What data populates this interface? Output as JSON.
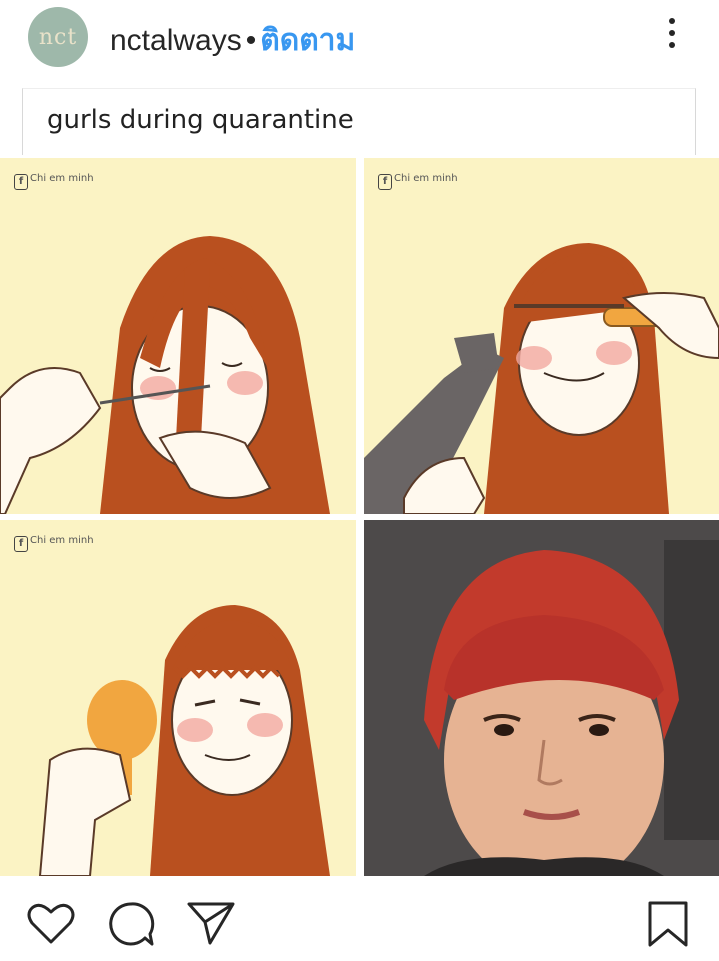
{
  "post": {
    "username": "nctalways",
    "separator": "•",
    "follow_label": "ติดตาม",
    "avatar_text": "nct",
    "caption": "gurls during quarantine",
    "panel_watermark": "Chi em minh"
  },
  "actions": {
    "like_icon": "heart-icon",
    "comment_icon": "comment-icon",
    "share_icon": "send-icon",
    "save_icon": "bookmark-icon"
  },
  "colors": {
    "follow": "#3897f0",
    "panel_bg": "#fbf3c4",
    "hair": "#b9501f"
  }
}
